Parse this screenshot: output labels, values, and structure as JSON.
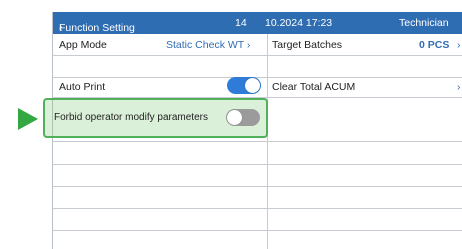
{
  "header": {
    "back_label": "Function Setting",
    "number": "14",
    "datetime": "10.2024 17:23",
    "user": "Technician"
  },
  "settings": {
    "app_mode": {
      "label": "App Mode",
      "value": "Static Check WT"
    },
    "target_batches": {
      "label": "Target Batches",
      "value": "0 PCS"
    },
    "auto_print": {
      "label": "Auto Print",
      "state": "on"
    },
    "clear_total": {
      "label": "Clear Total ACUM"
    },
    "forbid_modify": {
      "label": "Forbid operator modify parameters",
      "state": "off"
    }
  },
  "colors": {
    "titlebar": "#2f6db3",
    "accent": "#2f6db3",
    "toggle_on": "#2f7cd8",
    "toggle_off": "#9b9b9b",
    "highlight": "#52b05a",
    "pointer": "#33a840"
  },
  "icons": {
    "back": "chevron-left-icon",
    "next": "chevron-right-icon",
    "pointer": "triangle-right-icon"
  }
}
